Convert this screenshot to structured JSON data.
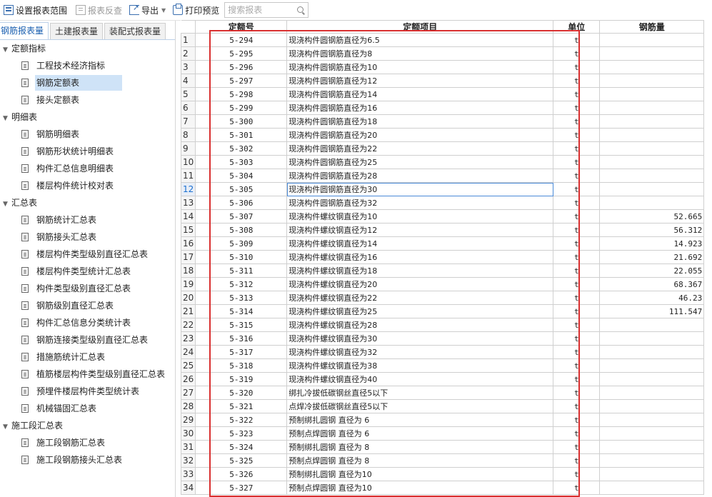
{
  "toolbar": {
    "set_range": "设置报表范围",
    "reverse_check": "报表反查",
    "export": "导出",
    "print_preview": "打印预览",
    "search_placeholder": "搜索报表"
  },
  "tabs": [
    "钢筋报表量",
    "土建报表量",
    "装配式报表量"
  ],
  "tree": {
    "groups": [
      {
        "label": "定额指标",
        "items": [
          "工程技术经济指标",
          "钢筋定额表",
          "接头定额表"
        ]
      },
      {
        "label": "明细表",
        "items": [
          "钢筋明细表",
          "钢筋形状统计明细表",
          "构件汇总信息明细表",
          "楼层构件统计校对表"
        ]
      },
      {
        "label": "汇总表",
        "items": [
          "钢筋统计汇总表",
          "钢筋接头汇总表",
          "楼层构件类型级别直径汇总表",
          "楼层构件类型统计汇总表",
          "构件类型级别直径汇总表",
          "钢筋级别直径汇总表",
          "构件汇总信息分类统计表",
          "钢筋连接类型级别直径汇总表",
          "措施筋统计汇总表",
          "植筋楼层构件类型级别直径汇总表",
          "预埋件楼层构件类型统计表",
          "机械锚固汇总表"
        ]
      },
      {
        "label": "施工段汇总表",
        "items": [
          "施工段钢筋汇总表",
          "施工段钢筋接头汇总表"
        ]
      }
    ],
    "selected": "钢筋定额表"
  },
  "grid": {
    "headers": [
      "定额号",
      "定额项目",
      "单位",
      "钢筋量"
    ],
    "current_row": 12,
    "rows": [
      {
        "n": "1",
        "code": "5-294",
        "item": "现浇构件圆钢筋直径为6.5",
        "unit": "t",
        "amount": ""
      },
      {
        "n": "2",
        "code": "5-295",
        "item": "现浇构件圆钢筋直径为8",
        "unit": "t",
        "amount": ""
      },
      {
        "n": "3",
        "code": "5-296",
        "item": "现浇构件圆钢筋直径为10",
        "unit": "t",
        "amount": ""
      },
      {
        "n": "4",
        "code": "5-297",
        "item": "现浇构件圆钢筋直径为12",
        "unit": "t",
        "amount": ""
      },
      {
        "n": "5",
        "code": "5-298",
        "item": "现浇构件圆钢筋直径为14",
        "unit": "t",
        "amount": ""
      },
      {
        "n": "6",
        "code": "5-299",
        "item": "现浇构件圆钢筋直径为16",
        "unit": "t",
        "amount": ""
      },
      {
        "n": "7",
        "code": "5-300",
        "item": "现浇构件圆钢筋直径为18",
        "unit": "t",
        "amount": ""
      },
      {
        "n": "8",
        "code": "5-301",
        "item": "现浇构件圆钢筋直径为20",
        "unit": "t",
        "amount": ""
      },
      {
        "n": "9",
        "code": "5-302",
        "item": "现浇构件圆钢筋直径为22",
        "unit": "t",
        "amount": ""
      },
      {
        "n": "10",
        "code": "5-303",
        "item": "现浇构件圆钢筋直径为25",
        "unit": "t",
        "amount": ""
      },
      {
        "n": "11",
        "code": "5-304",
        "item": "现浇构件圆钢筋直径为28",
        "unit": "t",
        "amount": ""
      },
      {
        "n": "12",
        "code": "5-305",
        "item": "现浇构件圆钢筋直径为30",
        "unit": "t",
        "amount": ""
      },
      {
        "n": "13",
        "code": "5-306",
        "item": "现浇构件圆钢筋直径为32",
        "unit": "t",
        "amount": ""
      },
      {
        "n": "14",
        "code": "5-307",
        "item": "现浇构件螺纹钢直径为10",
        "unit": "t",
        "amount": "52.665"
      },
      {
        "n": "15",
        "code": "5-308",
        "item": "现浇构件螺纹钢直径为12",
        "unit": "t",
        "amount": "56.312"
      },
      {
        "n": "16",
        "code": "5-309",
        "item": "现浇构件螺纹钢直径为14",
        "unit": "t",
        "amount": "14.923"
      },
      {
        "n": "17",
        "code": "5-310",
        "item": "现浇构件螺纹钢直径为16",
        "unit": "t",
        "amount": "21.692"
      },
      {
        "n": "18",
        "code": "5-311",
        "item": "现浇构件螺纹钢直径为18",
        "unit": "t",
        "amount": "22.055"
      },
      {
        "n": "19",
        "code": "5-312",
        "item": "现浇构件螺纹钢直径为20",
        "unit": "t",
        "amount": "68.367"
      },
      {
        "n": "20",
        "code": "5-313",
        "item": "现浇构件螺纹钢直径为22",
        "unit": "t",
        "amount": "46.23"
      },
      {
        "n": "21",
        "code": "5-314",
        "item": "现浇构件螺纹钢直径为25",
        "unit": "t",
        "amount": "111.547"
      },
      {
        "n": "22",
        "code": "5-315",
        "item": "现浇构件螺纹钢直径为28",
        "unit": "t",
        "amount": ""
      },
      {
        "n": "23",
        "code": "5-316",
        "item": "现浇构件螺纹钢直径为30",
        "unit": "t",
        "amount": ""
      },
      {
        "n": "24",
        "code": "5-317",
        "item": "现浇构件螺纹钢直径为32",
        "unit": "t",
        "amount": ""
      },
      {
        "n": "25",
        "code": "5-318",
        "item": "现浇构件螺纹钢直径为38",
        "unit": "t",
        "amount": ""
      },
      {
        "n": "26",
        "code": "5-319",
        "item": "现浇构件螺纹钢直径为40",
        "unit": "t",
        "amount": ""
      },
      {
        "n": "27",
        "code": "5-320",
        "item": "绑扎冷拔低碳钢丝直径5以下",
        "unit": "t",
        "amount": ""
      },
      {
        "n": "28",
        "code": "5-321",
        "item": "点焊冷拔低碳钢丝直径5以下",
        "unit": "t",
        "amount": ""
      },
      {
        "n": "29",
        "code": "5-322",
        "item": "预制绑扎圆钢 直径为 6",
        "unit": "t",
        "amount": ""
      },
      {
        "n": "30",
        "code": "5-323",
        "item": "预制点焊圆钢 直径为 6",
        "unit": "t",
        "amount": ""
      },
      {
        "n": "31",
        "code": "5-324",
        "item": "预制绑扎圆钢 直径为 8",
        "unit": "t",
        "amount": ""
      },
      {
        "n": "32",
        "code": "5-325",
        "item": "预制点焊圆钢 直径为 8",
        "unit": "t",
        "amount": ""
      },
      {
        "n": "33",
        "code": "5-326",
        "item": "预制绑扎圆钢 直径为10",
        "unit": "t",
        "amount": ""
      },
      {
        "n": "34",
        "code": "5-327",
        "item": "预制点焊圆钢 直径为10",
        "unit": "t",
        "amount": ""
      }
    ]
  }
}
